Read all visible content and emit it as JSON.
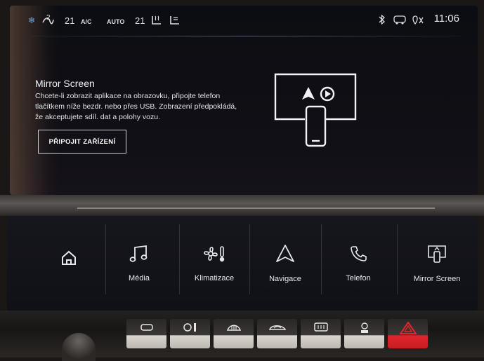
{
  "status_bar": {
    "fan_value": "2",
    "temp_left": "21",
    "ac_label": "A/C",
    "auto_label": "AUTO",
    "temp_right": "21",
    "clock": "11:06"
  },
  "mirror_screen": {
    "title": "Mirror Screen",
    "description": "Chcete-li zobrazit aplikace na obrazovku, připojte telefon tlačítkem níže bezdr. nebo přes USB. Zobrazení předpokládá, že akceptujete sdíl. dat a polohy vozu.",
    "connect_button": "PŘIPOJIT ZAŘÍZENÍ"
  },
  "dock": {
    "items": [
      {
        "label": "",
        "icon": "home-icon"
      },
      {
        "label": "Média",
        "icon": "music-note-icon"
      },
      {
        "label": "Klimatizace",
        "icon": "climate-icon"
      },
      {
        "label": "Navigace",
        "icon": "navigation-arrow-icon"
      },
      {
        "label": "Telefon",
        "icon": "phone-icon"
      },
      {
        "label": "Mirror Screen",
        "icon": "mirror-screen-icon"
      }
    ]
  },
  "hardware_buttons": [
    "seat-icon",
    "fan-heat-icon",
    "front-defrost-icon",
    "recirculation-icon",
    "rear-defrost-icon",
    "ac-off-icon",
    "hazard-icon"
  ],
  "colors": {
    "hazard": "#e0262b",
    "screen_bg": "#0c0d12",
    "text": "#e6e8ee"
  }
}
